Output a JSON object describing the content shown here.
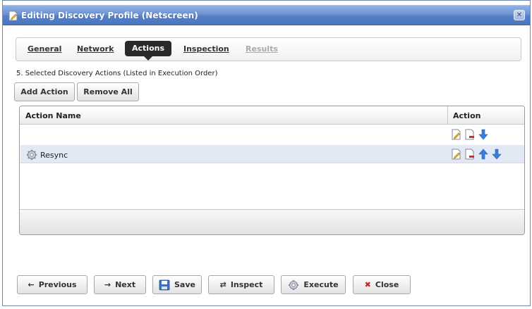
{
  "window": {
    "title": "Editing Discovery Profile (Netscreen)",
    "close_glyph": "✕"
  },
  "tabs": [
    {
      "label": "General",
      "state": "normal"
    },
    {
      "label": "Network",
      "state": "normal"
    },
    {
      "label": "Actions",
      "state": "active"
    },
    {
      "label": "Inspection",
      "state": "normal"
    },
    {
      "label": "Results",
      "state": "disabled"
    }
  ],
  "section": {
    "label": "5. Selected Discovery Actions (Listed in Execution Order)"
  },
  "toolbar": {
    "add_action": "Add Action",
    "remove_all": "Remove All"
  },
  "table": {
    "headers": {
      "name": "Action Name",
      "action": "Action"
    },
    "rows": [
      {
        "name": "",
        "icon": "",
        "actions": [
          "edit-icon",
          "delete-icon",
          "move-down-icon"
        ]
      },
      {
        "name": "Resync",
        "icon": "gear-icon",
        "actions": [
          "edit-icon",
          "delete-icon",
          "move-up-icon",
          "move-down-icon"
        ]
      }
    ]
  },
  "footer": {
    "previous": "Previous",
    "next": "Next",
    "save": "Save",
    "inspect": "Inspect",
    "execute": "Execute",
    "close": "Close"
  },
  "colors": {
    "title_bar": "#5a84c9",
    "selected_row": "#e2e8f4",
    "arrow_blue": "#3b7ddd",
    "close_red": "#cc2222"
  }
}
